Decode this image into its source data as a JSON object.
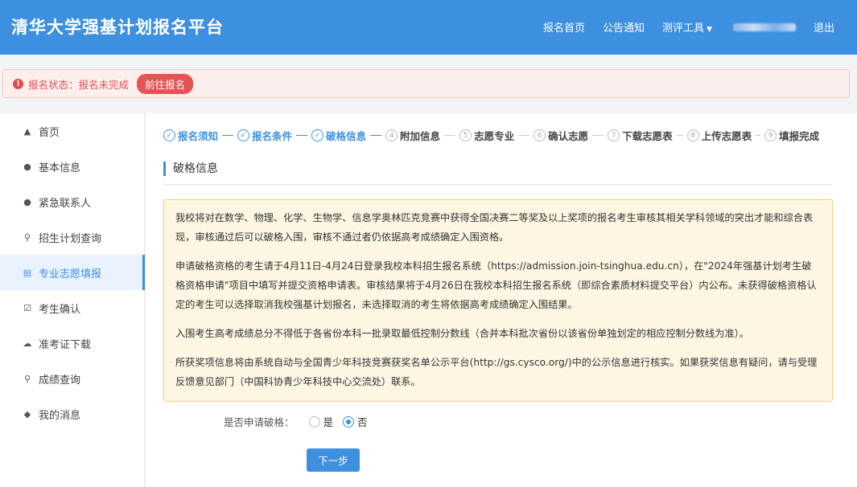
{
  "header": {
    "title": "清华大学强基计划报名平台",
    "nav": [
      "报名首页",
      "公告通知"
    ],
    "tools_label": "测评工具",
    "logout": "退出"
  },
  "alert": {
    "text": "报名状态：报名未完成",
    "action": "前往报名"
  },
  "sidebar": {
    "items": [
      {
        "label": "首页",
        "icon": "home-icon",
        "active": false
      },
      {
        "label": "基本信息",
        "icon": "user-icon",
        "active": false
      },
      {
        "label": "紧急联系人",
        "icon": "user-icon",
        "active": false
      },
      {
        "label": "招生计划查询",
        "icon": "search-icon",
        "active": false
      },
      {
        "label": "专业志愿填报",
        "icon": "document-icon",
        "active": true
      },
      {
        "label": "考生确认",
        "icon": "checkbox-icon",
        "active": false
      },
      {
        "label": "准考证下载",
        "icon": "cloud-download-icon",
        "active": false
      },
      {
        "label": "成绩查询",
        "icon": "search-icon",
        "active": false
      },
      {
        "label": "我的消息",
        "icon": "bell-icon",
        "active": false
      }
    ]
  },
  "steps": [
    {
      "num": "✓",
      "label": "报名须知",
      "done": true
    },
    {
      "num": "✓",
      "label": "报名条件",
      "done": true
    },
    {
      "num": "✓",
      "label": "破格信息",
      "done": true
    },
    {
      "num": "4",
      "label": "附加信息",
      "done": false
    },
    {
      "num": "5",
      "label": "志愿专业",
      "done": false
    },
    {
      "num": "6",
      "label": "确认志愿",
      "done": false
    },
    {
      "num": "7",
      "label": "下载志愿表",
      "done": false
    },
    {
      "num": "8",
      "label": "上传志愿表",
      "done": false
    },
    {
      "num": "9",
      "label": "填报完成",
      "done": false
    }
  ],
  "main": {
    "section_title": "破格信息",
    "notice": [
      "我校将对在数学、物理、化学、生物学、信息学奥林匹克竞赛中获得全国决赛二等奖及以上奖项的报名考生审核其相关学科领域的突出才能和综合表现，审核通过后可以破格入围，审核不通过者仍依据高考成绩确定入围资格。",
      "申请破格资格的考生请于4月11日-4月24日登录我校本科招生报名系统（https://admission.join-tsinghua.edu.cn），在\"2024年强基计划考生破格资格申请\"项目中填写并提交资格申请表。审核结果将于4月26日在我校本科招生报名系统（即综合素质材料提交平台）内公布。未获得破格资格认定的考生可以选择取消我校强基计划报名，未选择取消的考生将依据高考成绩确定入围结果。",
      "入围考生高考成绩总分不得低于各省份本科一批录取最低控制分数线（合并本科批次省份以该省份单独划定的相应控制分数线为准）。",
      "所获奖项信息将由系统自动与全国青少年科技竞赛获奖名单公示平台(http://gs.cysco.org/)中的公示信息进行核实。如果获奖信息有疑问，请与受理反馈意见部门（中国科协青少年科技中心交流处）联系。"
    ],
    "question": "是否申请破格：",
    "options": [
      {
        "label": "是",
        "checked": false
      },
      {
        "label": "否",
        "checked": true
      }
    ],
    "next": "下一步"
  }
}
